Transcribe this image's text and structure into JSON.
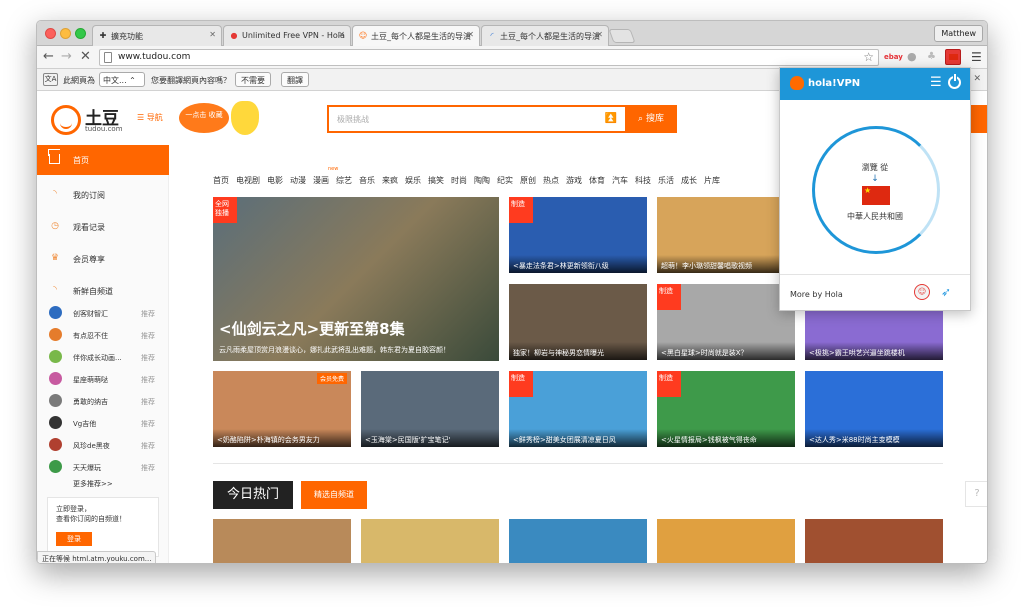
{
  "browser": {
    "tabs": [
      {
        "icon": "puzzle",
        "title": "擴充功能",
        "active": false
      },
      {
        "icon": "vpn",
        "title": "Unlimited Free VPN - Hola",
        "active": false
      },
      {
        "icon": "tudou",
        "title": "土豆_每个人都是生活的导演",
        "active": true
      },
      {
        "icon": "loading",
        "title": "土豆_每个人都是生活的导演",
        "active": false
      }
    ],
    "profile_name": "Matthew",
    "url": "www.tudou.com",
    "translate_bar": {
      "prefix": "此網頁為",
      "language": "中文...",
      "question": "您要翻譯網頁內容嗎？",
      "no_label": "不需要",
      "translate_label": "翻譯"
    },
    "extensions": {
      "ebay": "ebay"
    },
    "status_text": "正在等候 html.atm.youku.com..."
  },
  "site": {
    "logo_text": "土豆",
    "logo_sub": "tudou.com",
    "nav_link": "☰ 导航",
    "promo_text": "一点击\n收藏",
    "search_placeholder": "极限挑战",
    "search_button": "搜库",
    "sidebar": {
      "home": "首页",
      "items": [
        {
          "icon": "rss",
          "label": "我的订阅"
        },
        {
          "icon": "clock",
          "label": "观看记录"
        },
        {
          "icon": "crown",
          "label": "会员尊享"
        },
        {
          "icon": "rss",
          "label": "新鲜自频道"
        }
      ],
      "channels": [
        {
          "name": "创客财智汇",
          "tag": "推荐",
          "color": "#2d6cc0"
        },
        {
          "name": "有点忍不住",
          "tag": "推荐",
          "color": "#e57c2c"
        },
        {
          "name": "伴你成长动画...",
          "tag": "推荐",
          "color": "#79b84a"
        },
        {
          "name": "星座萌萌哒",
          "tag": "推荐",
          "color": "#c75aa0"
        },
        {
          "name": "勇敢的纳吉",
          "tag": "推荐",
          "color": "#7a7a7a"
        },
        {
          "name": "Vg吉他",
          "tag": "推荐",
          "color": "#333333"
        },
        {
          "name": "风珍de黑夜",
          "tag": "推荐",
          "color": "#b04030"
        },
        {
          "name": "天天爆玩",
          "tag": "推荐",
          "color": "#3d9a48"
        }
      ],
      "more": "更多推荐>>",
      "login_line1": "立即登录，",
      "login_line2": "查看你订阅的自频道！",
      "login_button": "登录"
    },
    "categories": [
      "首页",
      "电视剧",
      "电影",
      "动漫",
      "漫画",
      "综艺",
      "音乐",
      "来疯",
      "娱乐",
      "搞笑",
      "时尚",
      "陶陶",
      "纪实",
      "原创",
      "热点",
      "游戏",
      "体育",
      "汽车",
      "科技",
      "乐活",
      "成长",
      "片库"
    ],
    "category_new_tag": "new",
    "featured": {
      "badge": "全网独播",
      "title": "<仙剑云之凡>更新至第8集",
      "subtitle": "云凡雨柔屋顶赏月浪漫谈心，娜扎此武将乱出难题，韩东君为夏自胶容颜！"
    },
    "tiles": [
      {
        "badge": "制造",
        "caption": "<暴走法条君>林更新领衔八级",
        "color": "#2a5db0"
      },
      {
        "badge": "",
        "caption": "超萌！李小璐领甜馨唱歌视频",
        "color": "#d7a45a"
      },
      {
        "badge": "",
        "caption": "独家！柳岩与神秘男恋情曝光",
        "color": "#6b5a48"
      },
      {
        "badge": "制造",
        "caption": "<黑白星球>时尚就是装X？",
        "color": "#c8c8c8"
      },
      {
        "badge": "",
        "caption": "<极挑>霸王哄艺兴逼坐跳楼机",
        "color": "#8a6bd2"
      },
      {
        "badge": "会员免费",
        "caption": "<奶酪陷阱>朴海镇的会务男友力",
        "color": "#c9885a"
      },
      {
        "badge": "",
        "caption": "<玉海棠>民国版'扩宝笔记'",
        "color": "#5a6a7a"
      },
      {
        "badge": "制造",
        "caption": "<鲜秀榜>甜美女团展清凉夏日风",
        "color": "#4aa0d8"
      },
      {
        "badge": "制造",
        "caption": "<火星情报局>钱枫被气得丧命",
        "color": "#3e9a4a"
      },
      {
        "badge": "",
        "caption": "<达人秀>米88时尚主变模模",
        "color": "#2b6fd8"
      }
    ],
    "hot_section": "今日热门",
    "hot_tag": "精选自频道",
    "help": "?"
  },
  "hola": {
    "logo": "hola!VPN",
    "browse_from": "瀏覽 從",
    "arrow": "↓",
    "country": "中華人民共和國",
    "more_by": "More by Hola",
    "colors": {
      "blue": "#1e96d8",
      "orange": "#ff6a00",
      "flag_red": "#de2910"
    }
  }
}
